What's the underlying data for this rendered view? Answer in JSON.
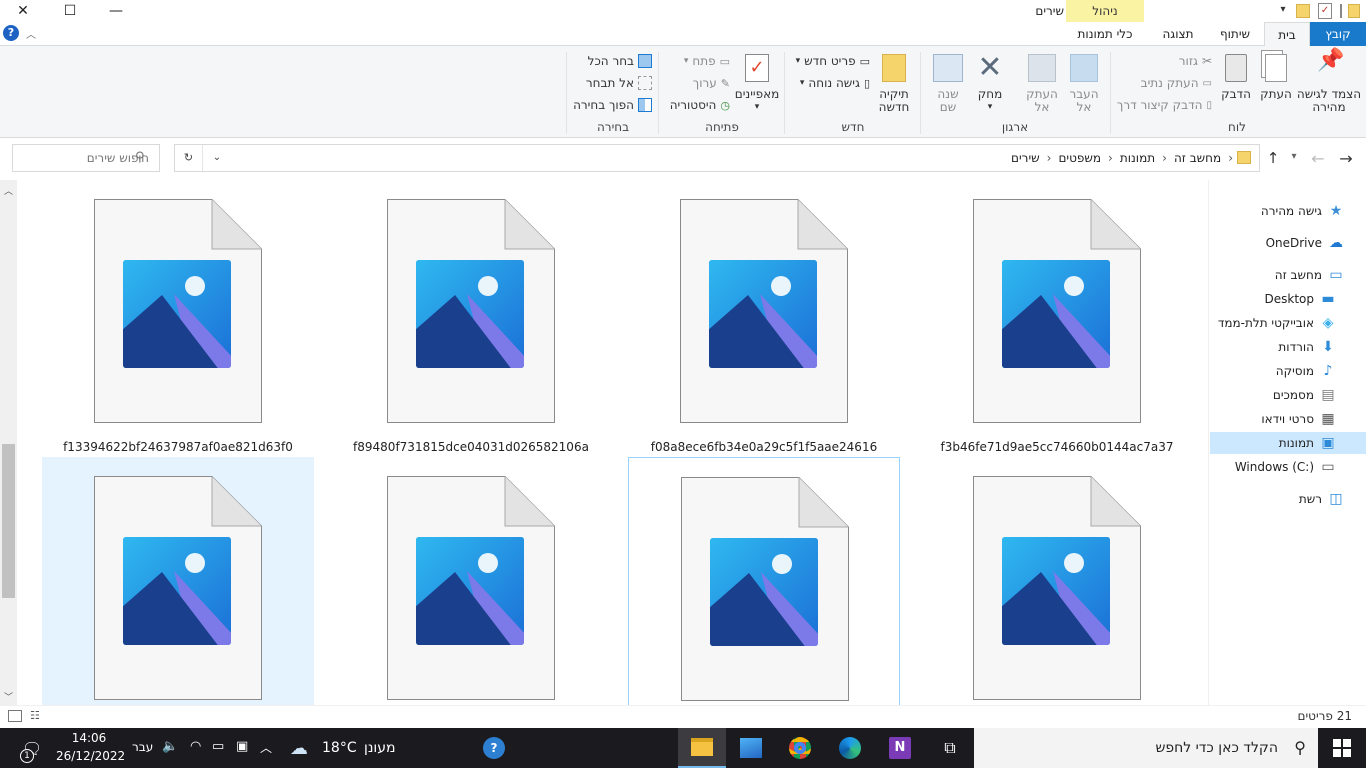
{
  "window": {
    "title": "שירים",
    "context_tab_header": "ניהול",
    "minimize": "—",
    "maximize": "☐",
    "close": "✕"
  },
  "ribbon_tabs": [
    {
      "label": "קובץ"
    },
    {
      "label": "בית"
    },
    {
      "label": "שיתוף"
    },
    {
      "label": "תצוגה"
    },
    {
      "label": "כלי תמונות"
    }
  ],
  "ribbon": {
    "clipboard": {
      "group_label": "לוח",
      "pin_line1": "הצמד לגישה",
      "pin_line2": "מהירה",
      "copy": "העתק",
      "paste": "הדבק",
      "cut": "גזור",
      "copy_path": "העתק נתיב",
      "paste_shortcut": "הדבק קיצור דרך"
    },
    "organize": {
      "group_label": "ארגון",
      "move_line1": "העבר",
      "move_line2": "אל",
      "copy_line1": "העתק",
      "copy_line2": "אל",
      "delete": "מחק",
      "rename_line1": "שנה",
      "rename_line2": "שם"
    },
    "new": {
      "group_label": "חדש",
      "new_folder_line1": "תיקיה",
      "new_folder_line2": "חדשה",
      "new_item": "פריט חדש",
      "easy_access": "גישה נוחה"
    },
    "open": {
      "group_label": "פתיחה",
      "properties": "מאפיינים",
      "open": "פתח",
      "edit": "ערוך",
      "history": "היסטוריה"
    },
    "select": {
      "group_label": "בחירה",
      "select_all": "בחר הכל",
      "select_none": "אל תבחר",
      "invert": "הפוך בחירה"
    }
  },
  "address": {
    "crumbs": [
      "מחשב זה",
      "תמונות",
      "משפטים",
      "שירים"
    ],
    "search_placeholder": "חיפוש שירים"
  },
  "files": [
    {
      "name": "f13394622bf24637987af0ae821d63f0"
    },
    {
      "name": "f89480f731815dce04031d026582106a"
    },
    {
      "name": "f08a8ece6fb34e0a29c5f1f5aae24616"
    },
    {
      "name": "f3b46fe71d9ae5cc74660b0144ac7a37"
    },
    {
      "name": ""
    },
    {
      "name": ""
    },
    {
      "name": ""
    },
    {
      "name": ""
    }
  ],
  "nav": [
    {
      "label": "גישה מהירה",
      "icon": "star-icon"
    },
    {
      "label": "OneDrive",
      "icon": "cloud-icon"
    },
    {
      "label": "מחשב זה",
      "icon": "computer-icon"
    },
    {
      "label": "Desktop",
      "icon": "desktop-icon"
    },
    {
      "label": "אובייקטי תלת-ממד",
      "icon": "cube-icon"
    },
    {
      "label": "הורדות",
      "icon": "download-icon"
    },
    {
      "label": "מוסיקה",
      "icon": "music-icon"
    },
    {
      "label": "מסמכים",
      "icon": "document-icon"
    },
    {
      "label": "סרטי וידאו",
      "icon": "film-icon"
    },
    {
      "label": "תמונות",
      "icon": "picture-icon"
    },
    {
      "label": "Windows (C:)",
      "icon": "drive-icon"
    },
    {
      "label": "רשת",
      "icon": "network-icon"
    }
  ],
  "status": {
    "item_count": "21 פריטים"
  },
  "taskbar": {
    "search_placeholder": "הקלד כאן כדי לחפש",
    "weather_temp": "18°C",
    "weather_text": "מעונן",
    "language": "עבר",
    "time": "14:06",
    "date": "26/12/2022",
    "notification_count": "1"
  },
  "colors": {
    "accent": "#0078d7",
    "selected_tile": "#e5f3ff",
    "context_tab": "#fbf3a4",
    "taskbar": "#1b1b1f"
  }
}
